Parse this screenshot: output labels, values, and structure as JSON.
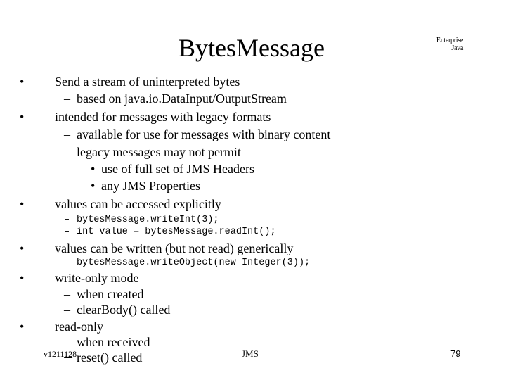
{
  "slide": {
    "title": "BytesMessage",
    "corner_label": [
      "Enterprise",
      "Java"
    ],
    "bullets": [
      {
        "level": 1,
        "marker": "•",
        "text": "Send a stream of uninterpreted bytes"
      },
      {
        "level": 2,
        "marker": "–",
        "text": "based on java.io.DataInput/OutputStream"
      },
      {
        "level": 1,
        "marker": "•",
        "text": "intended for messages with legacy formats"
      },
      {
        "level": 2,
        "marker": "–",
        "text": "available for use for messages with binary content"
      },
      {
        "level": 2,
        "marker": "–",
        "text": "legacy messages may not permit"
      },
      {
        "level": 3,
        "marker": "•",
        "text": "use of full set of JMS Headers"
      },
      {
        "level": 3,
        "marker": "•",
        "text": "any JMS Properties"
      },
      {
        "level": 1,
        "marker": "•",
        "text": "values can be accessed explicitly"
      },
      {
        "level": "code",
        "marker": "–",
        "text": "bytesMessage.writeInt(3);"
      },
      {
        "level": "code",
        "marker": "–",
        "text": "int value = bytesMessage.readInt();"
      },
      {
        "level": 1,
        "marker": "•",
        "text": "values can be written (but not read) generically"
      },
      {
        "level": "code",
        "marker": "–",
        "text": "bytesMessage.writeObject(new Integer(3));"
      },
      {
        "level": 1,
        "marker": "•",
        "text": "write-only mode"
      },
      {
        "level": 2,
        "marker": "–",
        "text": "when created"
      },
      {
        "level": 2,
        "marker": "–",
        "text": "clearBody() called"
      },
      {
        "level": 1,
        "marker": "•",
        "text": "read-only"
      },
      {
        "level": 2,
        "marker": "–",
        "text": "when received"
      },
      {
        "level": 2,
        "marker": "",
        "text": "reset() called"
      }
    ]
  },
  "footer": {
    "version_prefix": "v1211",
    "version_underlined": "12",
    "version_suffix": "8",
    "center": "JMS",
    "page_number": "79"
  }
}
